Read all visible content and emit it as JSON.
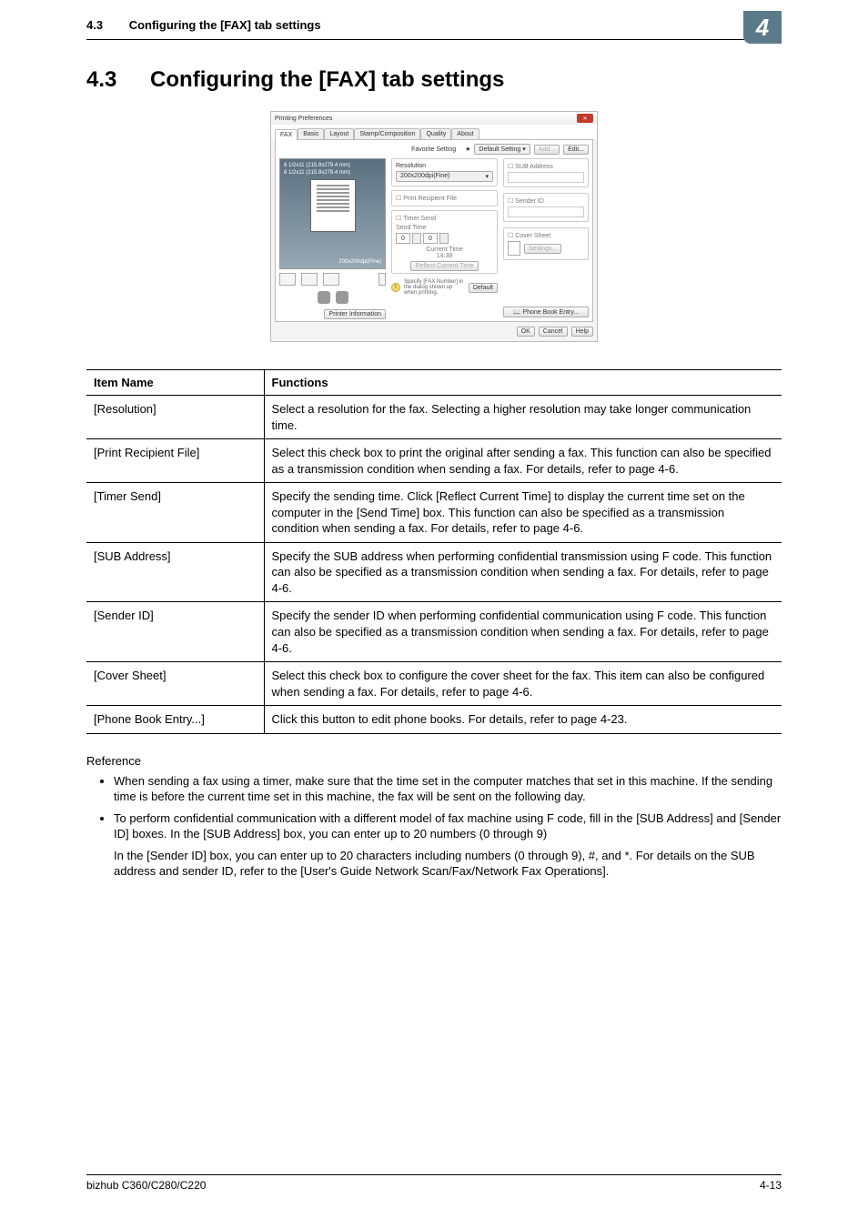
{
  "header": {
    "section_num": "4.3",
    "section_title": "Configuring the [FAX] tab settings",
    "badge": "4"
  },
  "heading": {
    "num": "4.3",
    "text": "Configuring the [FAX] tab settings"
  },
  "dialog": {
    "title": "Printing Preferences",
    "tabs": [
      "FAX",
      "Basic",
      "Layout",
      "Stamp/Composition",
      "Quality",
      "About"
    ],
    "favorite_label": "Favorite Setting",
    "default_setting": "Default Setting",
    "add_btn": "Add...",
    "edit_btn": "Edit...",
    "preview_size1": "8 1/2x11 (215.9x279.4 mm)",
    "preview_size2": "8 1/2x11 (215.9x279.4 mm)",
    "preview_res": "200x200dpi(Fine)",
    "resolution_label": "Resolution",
    "resolution_value": "200x200dpi(Fine)",
    "print_recipient_file": "Print Recipient File",
    "timer_send": "Timer Send",
    "send_time": "Send Time",
    "send_hh": "0",
    "send_mm": "0",
    "current_time_label": "Current Time",
    "current_time_value": "14:38",
    "reflect_btn": "Reflect Current Time",
    "sub_address": "SUB Address",
    "sender_id": "Sender ID",
    "cover_sheet": "Cover Sheet",
    "settings_btn": "Settings...",
    "phone_book_btn": "Phone Book Entry...",
    "printer_info_btn": "Printer Information",
    "hint": "Specify [FAX Number] in the dialog shown up when printing.",
    "default_btn": "Default",
    "ok": "OK",
    "cancel": "Cancel",
    "help": "Help"
  },
  "table": {
    "head_item": "Item Name",
    "head_func": "Functions",
    "rows": [
      {
        "item": "[Resolution]",
        "func": "Select a resolution for the fax. Selecting a higher resolution may take longer communication time."
      },
      {
        "item": "[Print Recipient File]",
        "func": "Select this check box to print the original after sending a fax. This function can also be specified as a transmission condition when sending a fax. For details, refer to page 4-6."
      },
      {
        "item": "[Timer Send]",
        "func": "Specify the sending time. Click [Reflect Current Time] to display the current time set on the computer in the [Send Time] box. This function can also be specified as a transmission condition when sending a fax. For details, refer to page 4-6."
      },
      {
        "item": "[SUB Address]",
        "func": "Specify the SUB address when performing confidential transmission using F code. This function can also be specified as a transmission condition when sending a fax. For details, refer to page 4-6."
      },
      {
        "item": "[Sender ID]",
        "func": "Specify the sender ID when performing confidential communication using F code. This function can also be specified as a transmission condition when sending a fax. For details, refer to page 4-6."
      },
      {
        "item": "[Cover Sheet]",
        "func": "Select this check box to configure the cover sheet for the fax. This item can also be configured when sending a fax. For details, refer to page 4-6."
      },
      {
        "item": "[Phone Book Entry...]",
        "func": "Click this button to edit phone books. For details, refer to page 4-23."
      }
    ]
  },
  "reference": {
    "label": "Reference",
    "bullets": [
      "When sending a fax using a timer, make sure that the time set in the computer matches that set in this machine. If the sending time is before the current time set in this machine, the fax will be sent on the following day.",
      "To perform confidential communication with a different model of fax machine using F code, fill in the [SUB Address] and [Sender ID] boxes. In the [SUB Address] box, you can enter up to 20 numbers (0 through 9)"
    ],
    "continuation": "In the [Sender ID] box, you can enter up to 20 characters including numbers (0 through 9), #, and *. For details on the SUB address and sender ID, refer to the [User's Guide Network Scan/Fax/Network Fax Operations]."
  },
  "footer": {
    "left": "bizhub C360/C280/C220",
    "right": "4-13"
  }
}
